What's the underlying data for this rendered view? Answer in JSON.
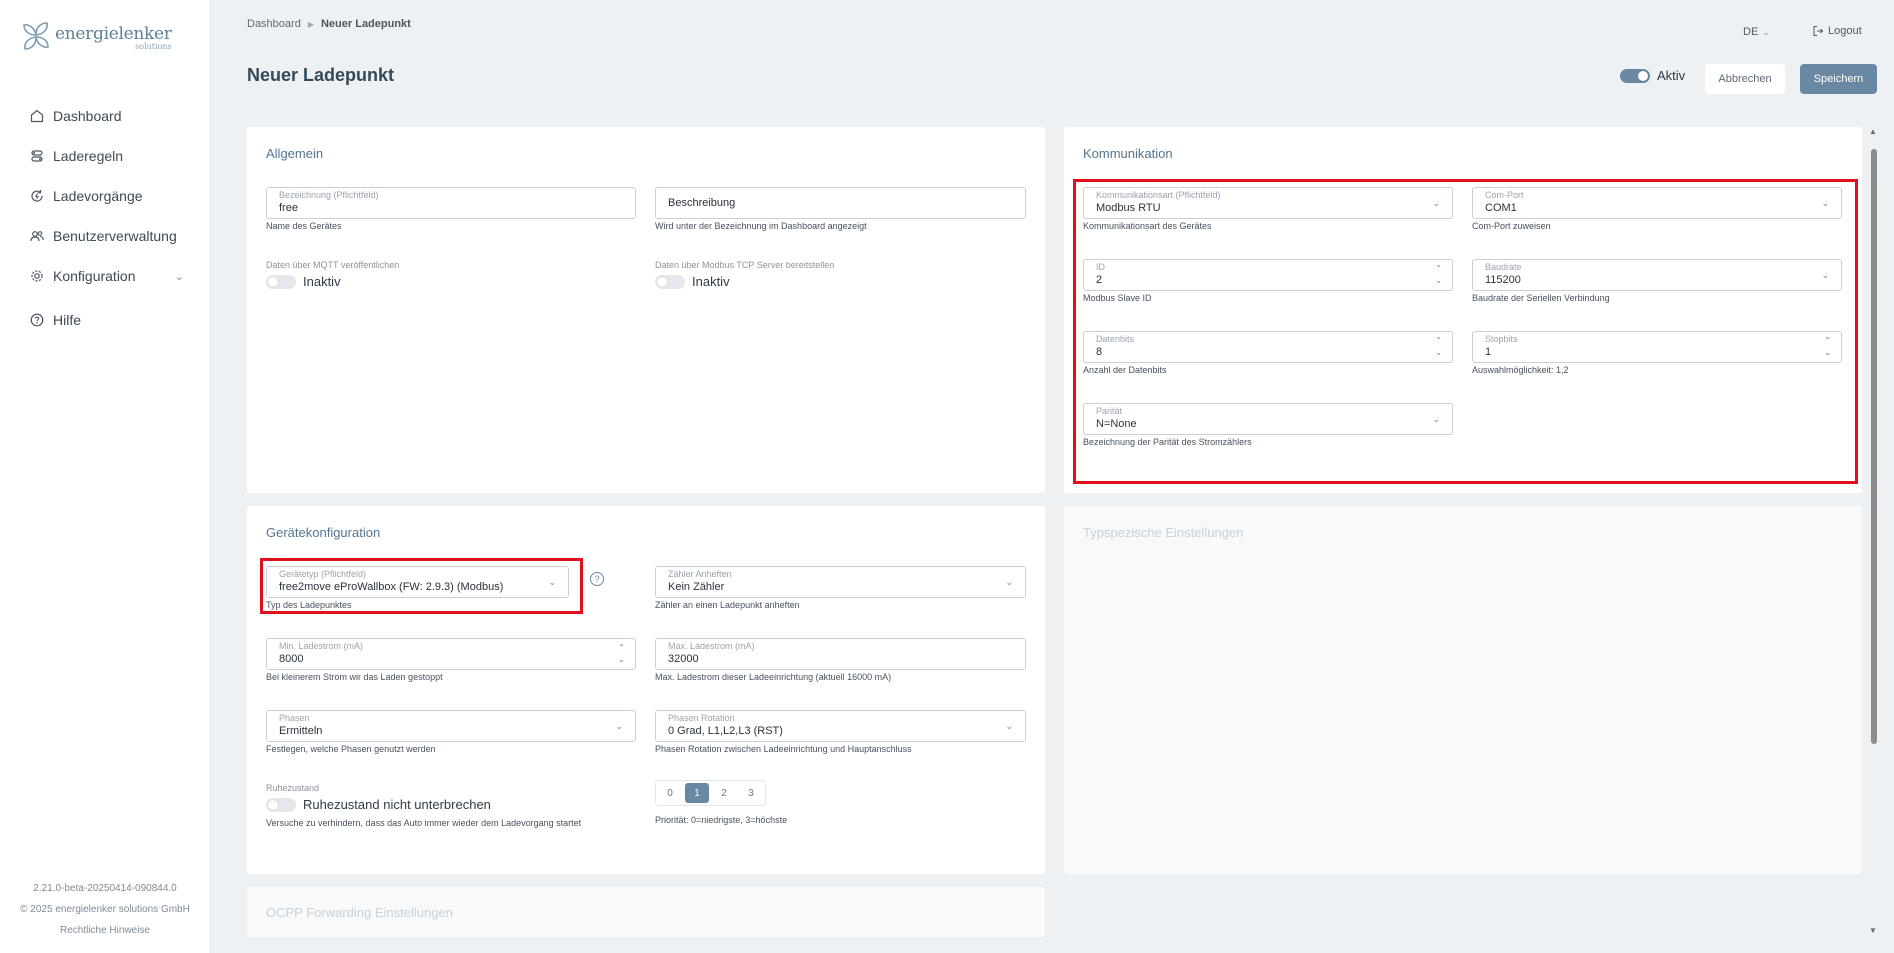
{
  "brand": {
    "name": "energielenker",
    "sub": "solutions"
  },
  "nav": {
    "items": [
      {
        "label": "Dashboard"
      },
      {
        "label": "Laderegeln"
      },
      {
        "label": "Ladevorgänge"
      },
      {
        "label": "Benutzerverwaltung"
      },
      {
        "label": "Konfiguration"
      },
      {
        "label": "Hilfe"
      }
    ]
  },
  "footer": {
    "version": "2.21.0-beta-20250414-090844.0",
    "copyright": "© 2025 energielenker solutions GmbH",
    "legal": "Rechtliche Hinweise"
  },
  "header": {
    "breadcrumb": [
      "Dashboard",
      "Neuer Ladepunkt"
    ],
    "lang": "DE",
    "logout": "Logout",
    "title": "Neuer Ladepunkt",
    "active_label": "Aktiv",
    "cancel": "Abbrechen",
    "save": "Speichern"
  },
  "allgemein": {
    "title": "Allgemein",
    "name_label": "Bezeichnung (Pflichtfeld)",
    "name_value": "free",
    "name_hint": "Name des Gerätes",
    "desc_placeholder": "Beschreibung",
    "desc_hint": "Wird unter der Bezeichnung im Dashboard angezeigt",
    "mqtt_label": "Daten über MQTT veröffentlichen",
    "mqtt_state": "Inaktiv",
    "modbus_label": "Daten über Modbus TCP Server bereitstellen",
    "modbus_state": "Inaktiv"
  },
  "kommunikation": {
    "title": "Kommunikation",
    "art_label": "Kommunikationsart (Pflichtfeld)",
    "art_value": "Modbus RTU",
    "art_hint": "Kommunikationsart des Gerätes",
    "port_label": "Com-Port",
    "port_value": "COM1",
    "port_hint": "Com-Port zuweisen",
    "id_label": "ID",
    "id_value": "2",
    "id_hint": "Modbus Slave ID",
    "baud_label": "Baudrate",
    "baud_value": "115200",
    "baud_hint": "Baudrate der Seriellen Verbindung",
    "databits_label": "Datenbits",
    "databits_value": "8",
    "databits_hint": "Anzahl der Datenbits",
    "stopbits_label": "Stopbits",
    "stopbits_value": "1",
    "stopbits_hint": "Auswahlmöglichkeit: 1,2",
    "parity_label": "Parität",
    "parity_value": "N=None",
    "parity_hint": "Bezeichnung der Parität des Stromzählers"
  },
  "geraet": {
    "title": "Gerätekonfiguration",
    "type_label": "Gerätetyp (Pflichtfeld)",
    "type_value": "free2move eProWallbox (FW: 2.9.3) (Modbus)",
    "type_hint": "Typ des Ladepunktes",
    "help": "?",
    "meter_label": "Zähler Anheften",
    "meter_value": "Kein Zähler",
    "meter_hint": "Zähler an einen Ladepunkt anheften",
    "min_label": "Min. Ladestrom (mA)",
    "min_value": "8000",
    "min_hint": "Bei kleinerem Strom wir das Laden gestoppt",
    "max_label": "Max. Ladestrom (mA)",
    "max_value": "32000",
    "max_hint": "Max. Ladestrom dieser Ladeeinrichtung (aktuell 16000 mA)",
    "phases_label": "Phasen",
    "phases_value": "Ermitteln",
    "phases_hint": "Festlegen, welche Phasen genutzt werden",
    "rotation_label": "Phasen Rotation",
    "rotation_value": "0 Grad, L1,L2,L3 (RST)",
    "rotation_hint": "Phasen Rotation zwischen Ladeeinrichtung und Hauptanschluss",
    "rest_label": "Ruhezustand",
    "rest_toggle": "Ruhezustand nicht unterbrechen",
    "rest_hint": "Versuche zu verhindern, dass das Auto immer wieder dem Ladevorgang startet",
    "priority_options": [
      "0",
      "1",
      "2",
      "3"
    ],
    "priority_selected": 1,
    "priority_hint": "Priorität: 0=niedrigste, 3=höchste"
  },
  "typspezifisch": {
    "title": "Typspezische Einstellungen"
  },
  "ocpp": {
    "title": "OCPP Forwarding Einstellungen"
  }
}
